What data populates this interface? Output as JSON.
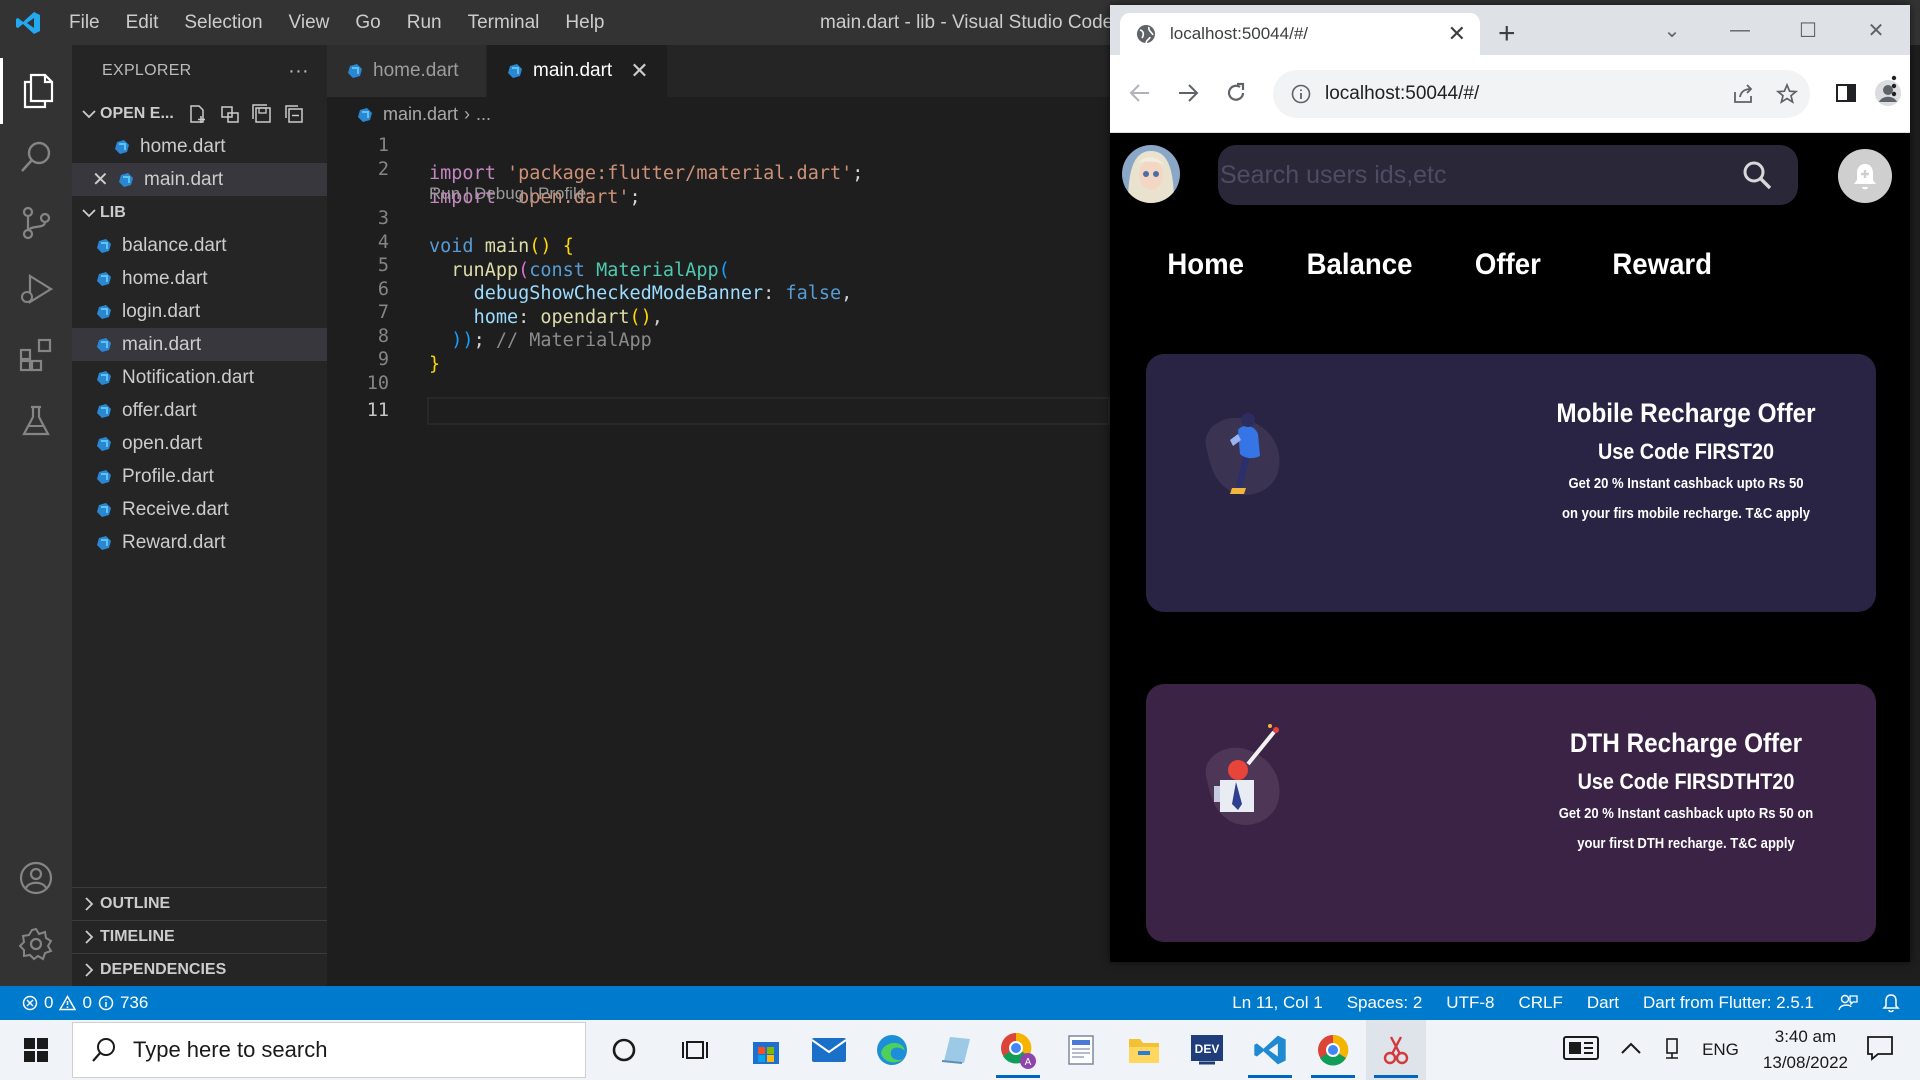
{
  "vscode": {
    "menu": [
      "File",
      "Edit",
      "Selection",
      "View",
      "Go",
      "Run",
      "Terminal",
      "Help"
    ],
    "window_title": "main.dart - lib - Visual Studio Code",
    "explorer_title": "EXPLORER",
    "explorer_more": "···",
    "open_editors_label": "OPEN E...",
    "open_editors": [
      "home.dart",
      "main.dart"
    ],
    "lib_label": "LIB",
    "lib_files": [
      "balance.dart",
      "home.dart",
      "login.dart",
      "main.dart",
      "Notification.dart",
      "offer.dart",
      "open.dart",
      "Profile.dart",
      "Receive.dart",
      "Reward.dart"
    ],
    "bottom_sections": [
      "OUTLINE",
      "TIMELINE",
      "DEPENDENCIES"
    ],
    "tabs": [
      {
        "label": "home.dart"
      },
      {
        "label": "main.dart"
      }
    ],
    "breadcrumb": {
      "file": "main.dart",
      "rest": "..."
    },
    "line_numbers": [
      "1",
      "2",
      "3",
      "4",
      "5",
      "6",
      "7",
      "8",
      "9",
      "10",
      "11"
    ],
    "codelens": "Run | Debug | Profile",
    "code": {
      "l1_kw": "import",
      "l1_str": "'package:flutter/material.dart'",
      "l1_end": ";",
      "l2_kw": "import",
      "l2_str": "'open.dart'",
      "l2_end": ";",
      "l3_kw": "void",
      "l3_fn": "main",
      "l3_paren": "()",
      "l3_brace": "{",
      "l4_fn": "runApp",
      "l4_paren": "(",
      "l4_kw": "const",
      "l4_cls": "MaterialApp",
      "l4_paren2": "(",
      "l5_prop": "debugShowCheckedModeBanner",
      "l5_colon": ":",
      "l5_val": "false",
      "l5_comma": ",",
      "l6_prop": "home",
      "l6_colon": ":",
      "l6_fn": "opendart",
      "l6_paren": "()",
      "l6_comma": ",",
      "l7_close": "))",
      "l7_semi": ";",
      "l7_comment": "// MaterialApp",
      "l8_brace": "}"
    },
    "status": {
      "errors": "0",
      "warnings": "0",
      "info": "736",
      "position": "Ln 11, Col 1",
      "spaces": "Spaces: 2",
      "encoding": "UTF-8",
      "eol": "CRLF",
      "language": "Dart",
      "sdk": "Dart from Flutter: 2.5.1"
    }
  },
  "chrome": {
    "tab_title": "localhost:50044/#/",
    "url": "localhost:50044/#/"
  },
  "app": {
    "search_placeholder": "Search users ids,etc",
    "nav": [
      "Home",
      "Balance",
      "Offer",
      "Reward"
    ],
    "offers": [
      {
        "title": "Mobile Recharge Offer",
        "code": "Use Code FIRST20",
        "desc1": "Get 20 % Instant cashback upto Rs 50",
        "desc2": "on your firs mobile recharge. T&C apply",
        "color": "#2a2444"
      },
      {
        "title": "DTH Recharge Offer",
        "code": "Use Code FIRSDTHT20",
        "desc1": "Get 20 % Instant cashback upto Rs 50 on",
        "desc2": "your first DTH recharge. T&C apply",
        "color": "#3b2345"
      }
    ]
  },
  "taskbar": {
    "search_placeholder": "Type here to search",
    "language": "ENG",
    "time": "3:40 am",
    "date": "13/08/2022"
  },
  "colors": {
    "statusbar": "#007acc",
    "activity_bar": "#333333",
    "sidebar": "#252526",
    "editor": "#1e1e1e"
  }
}
